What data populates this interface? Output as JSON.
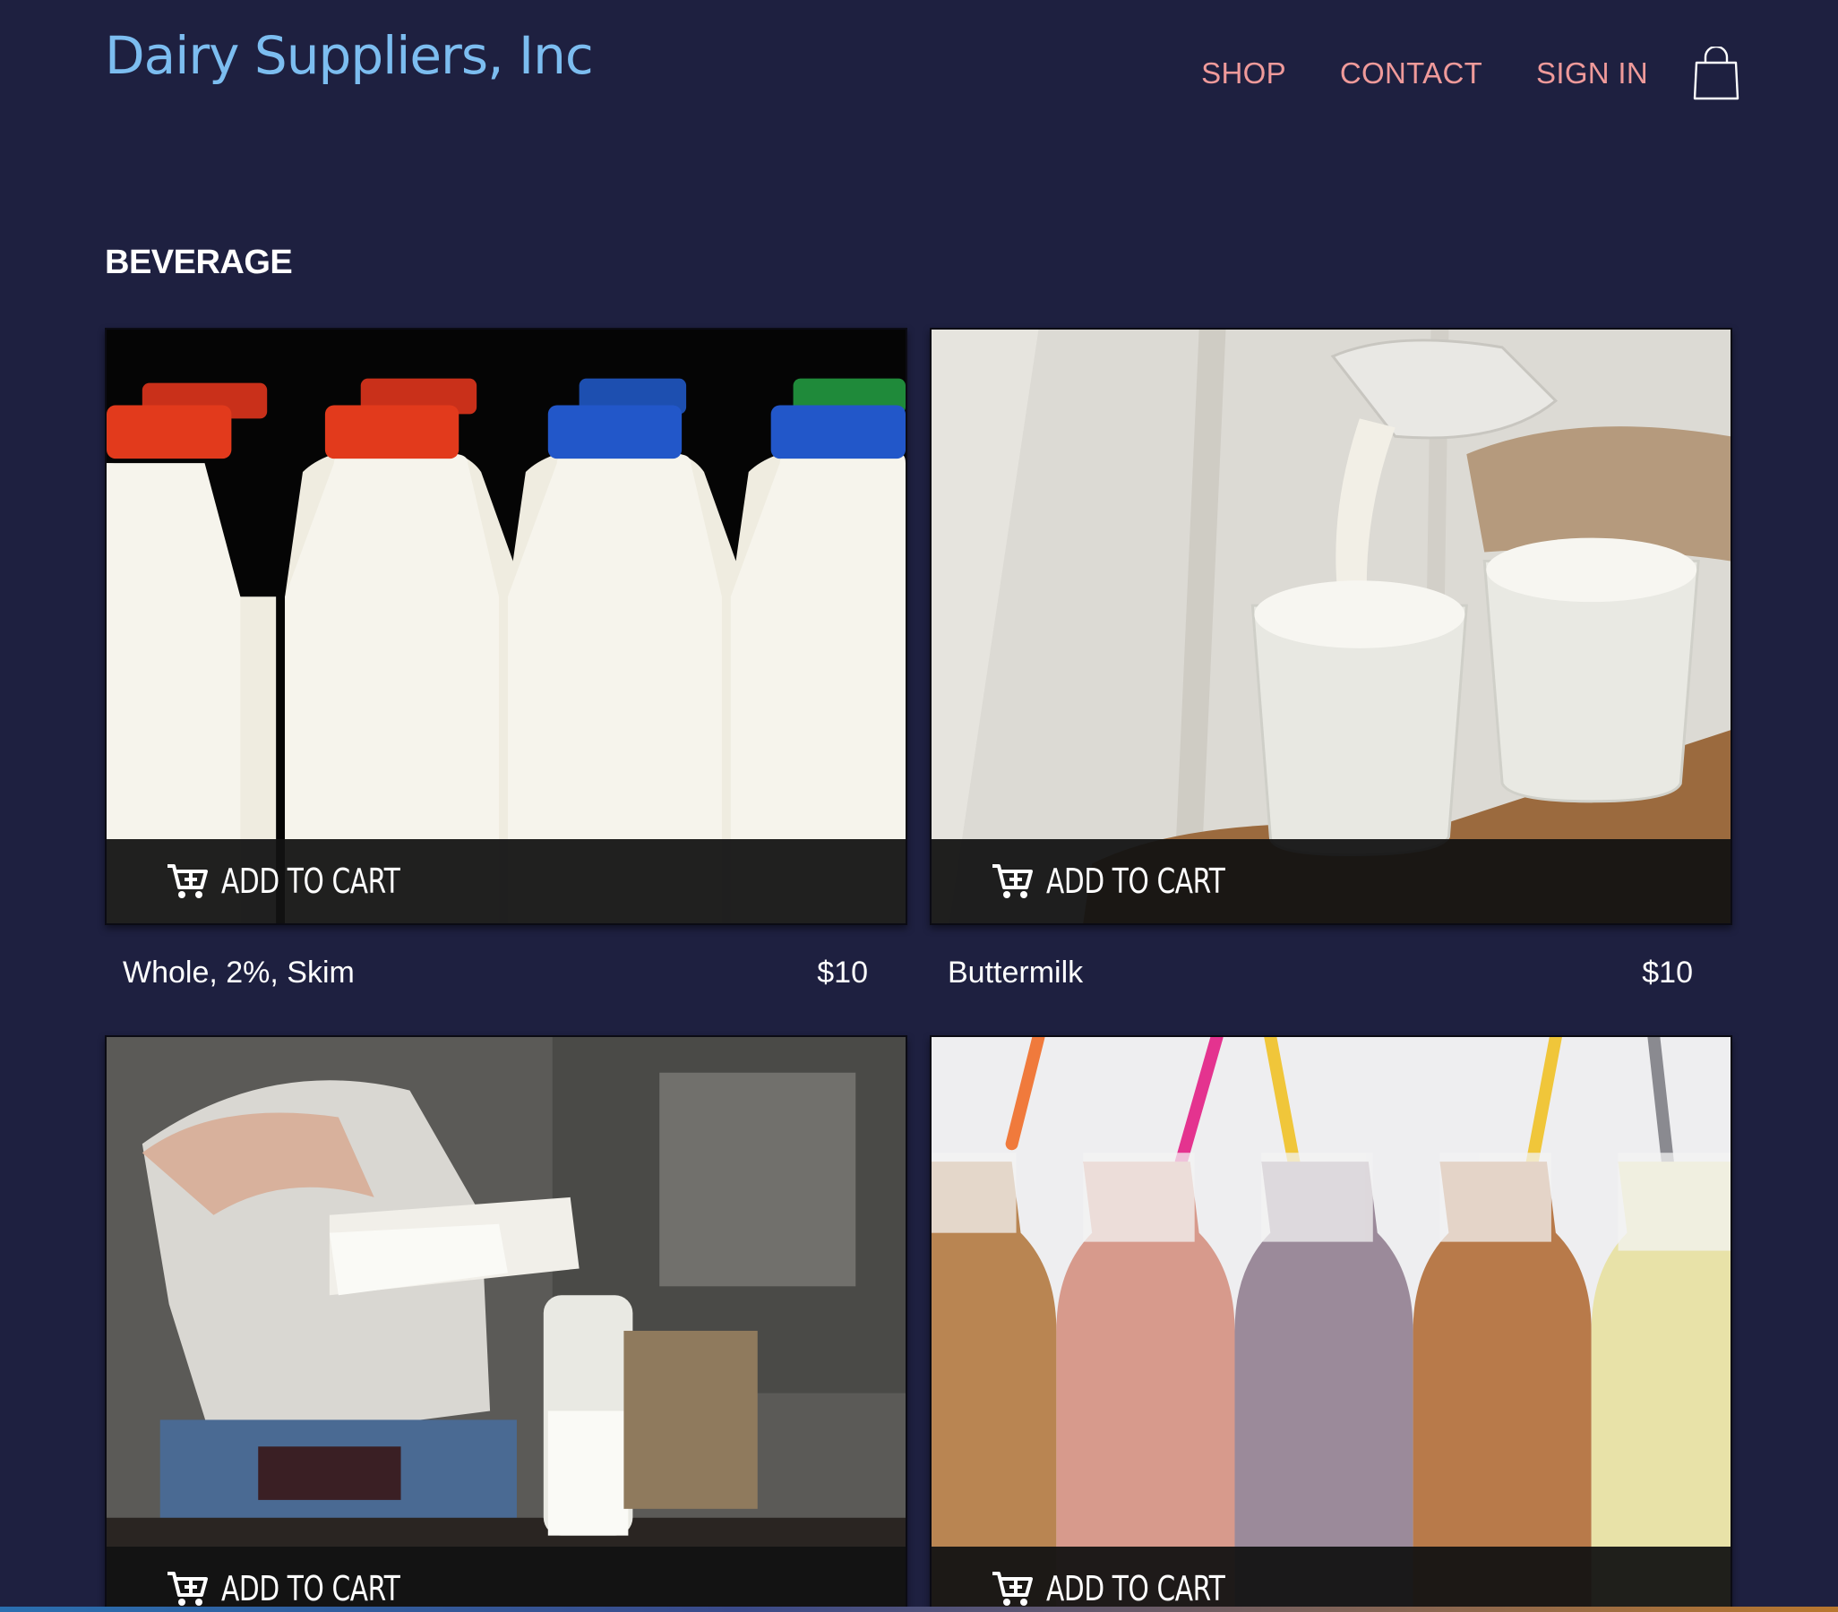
{
  "header": {
    "brand": "Dairy Suppliers, Inc",
    "nav": [
      "SHOP",
      "CONTACT",
      "SIGN IN"
    ],
    "cart_icon": "shopping-bag-icon"
  },
  "section": {
    "title": "BEVERAGE"
  },
  "products": [
    {
      "name": "Whole, 2%, Skim",
      "price": "$10",
      "button": "ADD TO CART",
      "image": "milk-bottles-with-caps"
    },
    {
      "name": "Buttermilk",
      "price": "$10",
      "button": "ADD TO CART",
      "image": "milk-pouring-into-glasses"
    },
    {
      "name": "",
      "price": "",
      "button": "ADD TO CART",
      "image": "pouring-milk-from-bottle"
    },
    {
      "name": "",
      "price": "",
      "button": "ADD TO CART",
      "image": "milkshake-bottles-with-straws"
    }
  ],
  "colors": {
    "background": "#1e2040",
    "brand": "#7cbdf0",
    "nav": "#ef9a9a"
  }
}
